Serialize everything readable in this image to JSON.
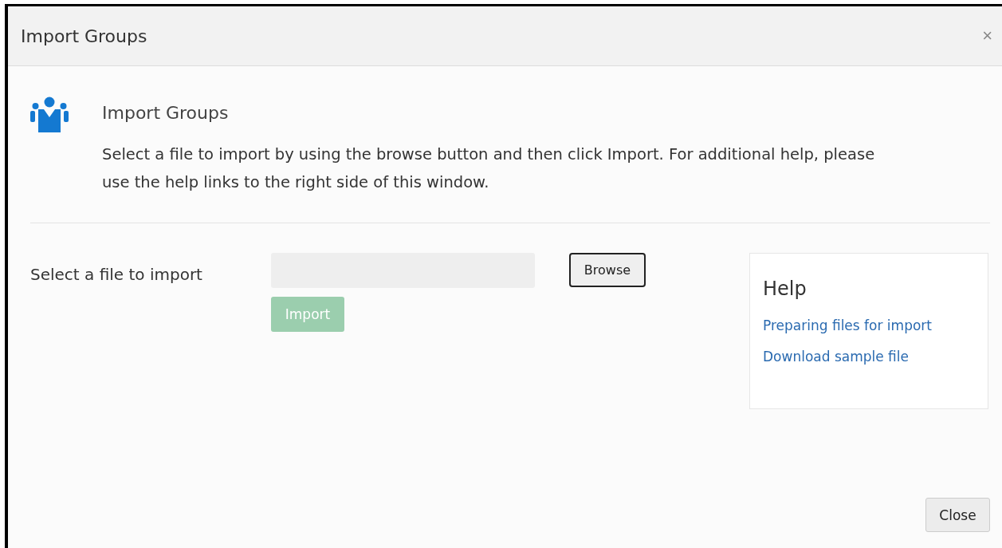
{
  "window": {
    "title": "Import Groups",
    "close_glyph": "×"
  },
  "intro": {
    "title": "Import Groups",
    "description": "Select a file to import by using the browse button and then click Import. For additional help, please use the help links to the right side of this window."
  },
  "file_row": {
    "label": "Select a file to import",
    "browse_button": "Browse",
    "import_button": {
      "label": "Import",
      "disabled": true
    }
  },
  "help": {
    "title": "Help",
    "links": [
      "Preparing files for import",
      "Download sample file"
    ]
  },
  "buttons": [
    "Close"
  ]
}
